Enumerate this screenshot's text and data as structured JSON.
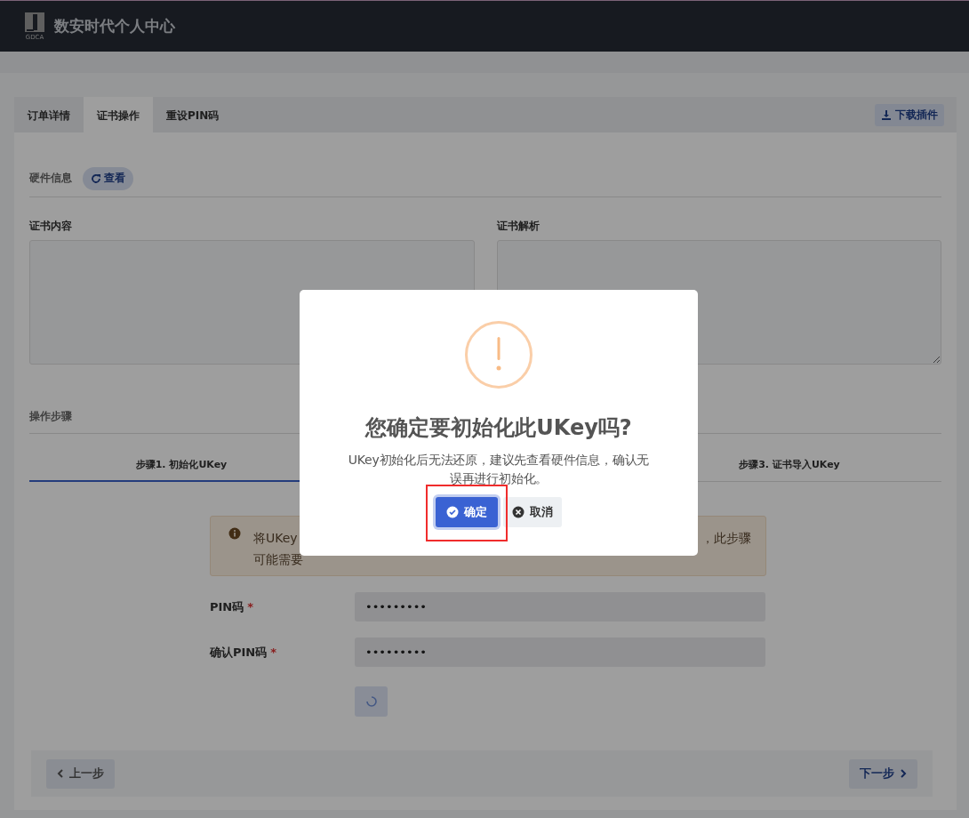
{
  "header": {
    "logo_text": "GDCA",
    "title": "数安时代个人中心"
  },
  "tabs": [
    {
      "label": "订单详情",
      "selected": false
    },
    {
      "label": "证书操作",
      "selected": true
    },
    {
      "label": "重设PIN码",
      "selected": false
    }
  ],
  "download_button": "下载插件",
  "hardware": {
    "label": "硬件信息",
    "button": "查看"
  },
  "panels": [
    {
      "label": "证书内容"
    },
    {
      "label": "证书解析"
    }
  ],
  "steps_section": {
    "title": "操作步骤",
    "steps": [
      {
        "label": "步骤1. 初始化UKey",
        "selected": true
      },
      {
        "label": "步骤3. 证书导入UKey",
        "selected": false
      }
    ]
  },
  "alert": {
    "line_1_start": "将UKey",
    "line_1_end": "，此步骤",
    "line_2_start": "可能需要"
  },
  "fields": [
    {
      "label": "PIN码",
      "required_mark": "*",
      "value": "•••••••••"
    },
    {
      "label": "确认PIN码",
      "required_mark": "*",
      "value": "•••••••••"
    }
  ],
  "submit_loading": true,
  "nav": {
    "prev": "上一步",
    "next": "下一步"
  },
  "dialog": {
    "title": "您确定要初始化此UKey吗?",
    "message": "UKey初始化后无法还原，建议先查看硬件信息，确认无误再进行初始化。",
    "confirm": {
      "label": "确定",
      "highlighted": true
    },
    "cancel": "取消"
  }
}
